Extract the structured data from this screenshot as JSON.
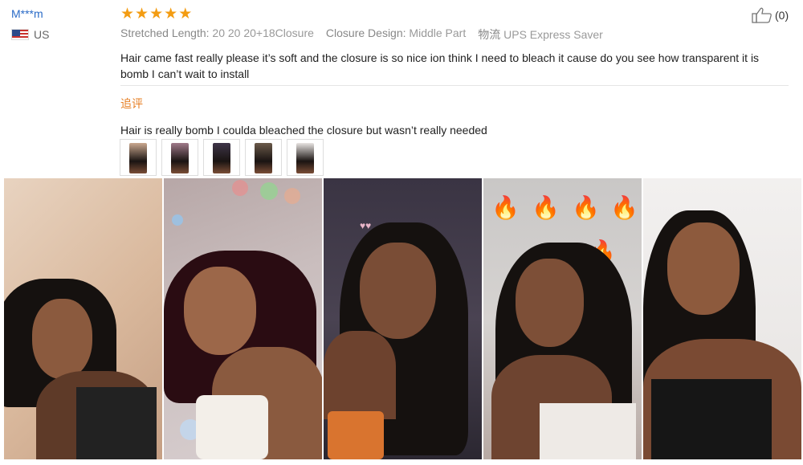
{
  "reviewer": {
    "name": "M***m",
    "country": "US"
  },
  "rating": {
    "stars": 5
  },
  "likes": {
    "count_label": "(0)"
  },
  "meta": {
    "stretched_length_label": "Stretched Length:",
    "stretched_length_value": "20 20 20+18Closure",
    "closure_design_label": "Closure Design:",
    "closure_design_value": "Middle Part",
    "logistics_label": "物流",
    "logistics_value": "UPS Express Saver"
  },
  "review_text": "Hair came fast really please it’s soft and the closure is so nice ion think I need to bleach it cause do you see how transparent it is bomb I can’t wait to install",
  "followup": {
    "label": "追评",
    "text": "Hair is really bomb I coulda bleached the closure but wasn’t really needed"
  },
  "thumbnails": [
    {
      "name": "review-thumbnail-1",
      "bg": "#caa88f"
    },
    {
      "name": "review-thumbnail-2",
      "bg": "#a07a8a"
    },
    {
      "name": "review-thumbnail-3",
      "bg": "#3e3548"
    },
    {
      "name": "review-thumbnail-4",
      "bg": "#6b5a4a"
    },
    {
      "name": "review-thumbnail-5",
      "bg": "#e8e4e2"
    }
  ],
  "colors": {
    "accent_star": "#f39c12",
    "username": "#2a6bc7",
    "followup_label": "#e67e22"
  }
}
